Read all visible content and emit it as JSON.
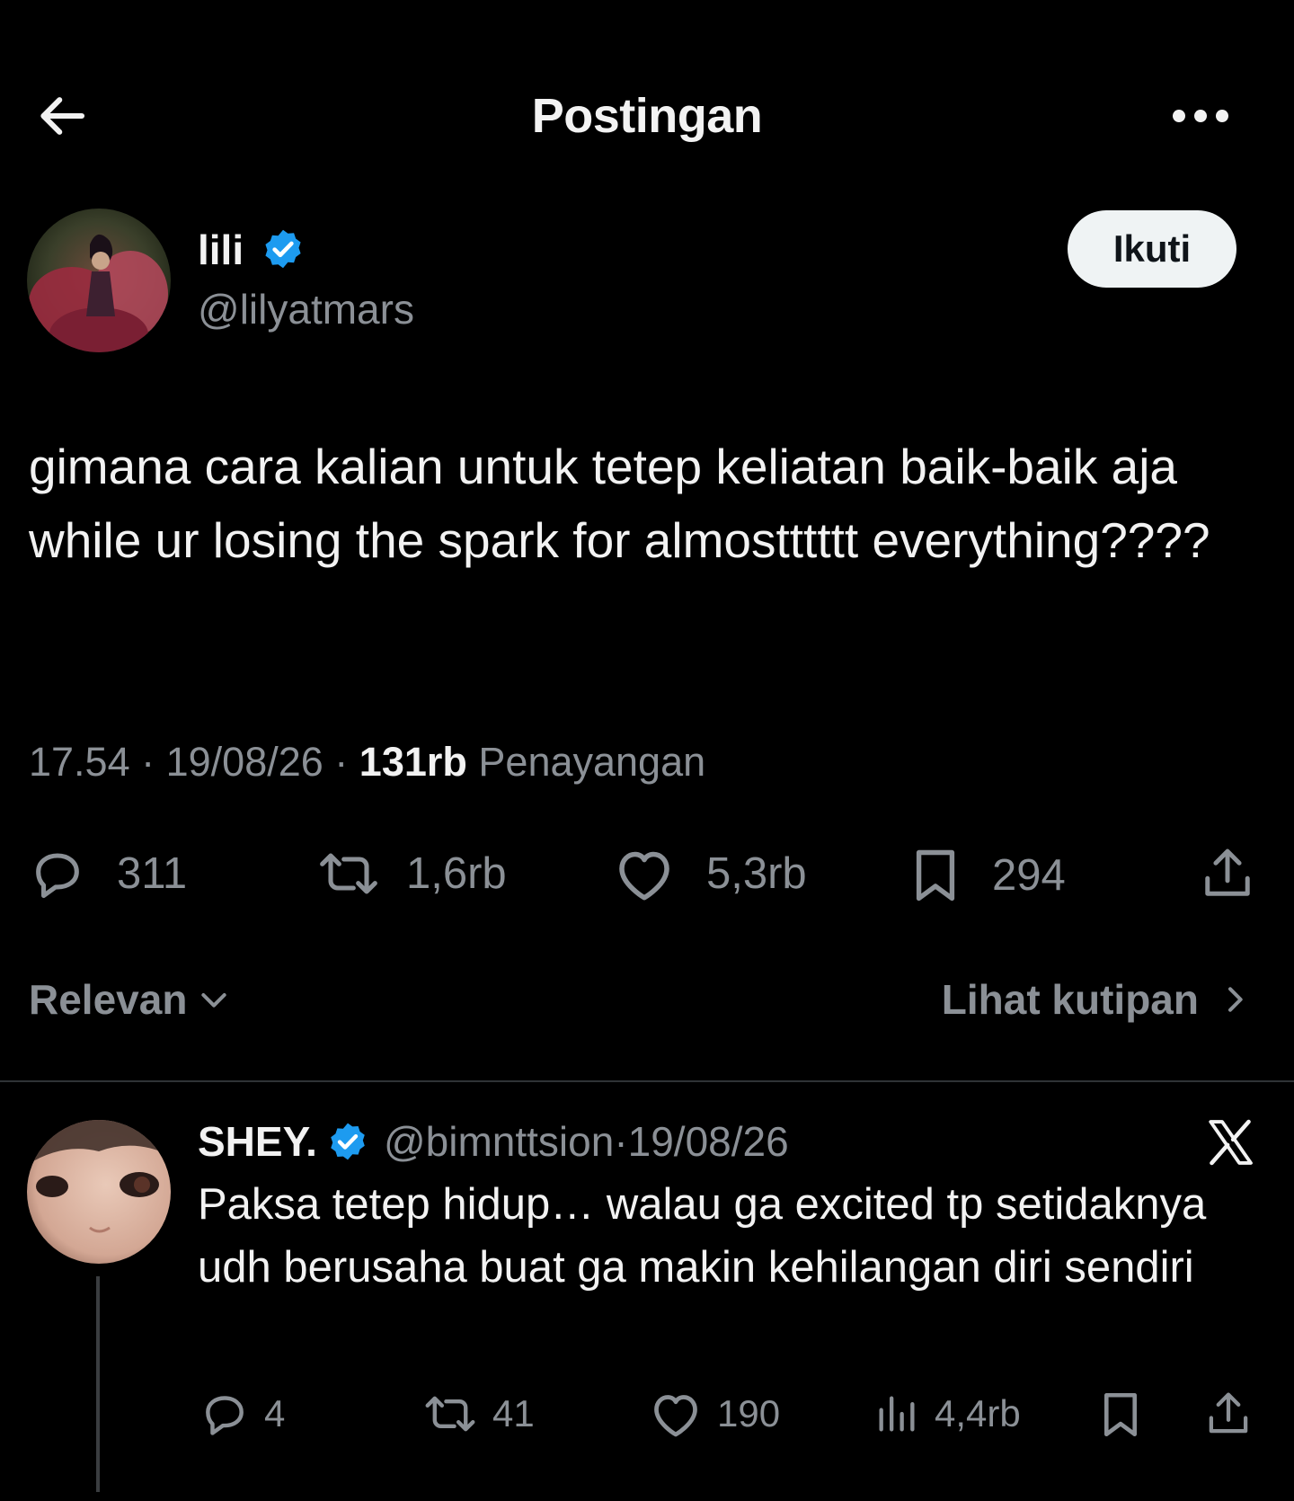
{
  "header": {
    "title": "Postingan"
  },
  "post": {
    "author_name": "lili",
    "author_handle": "@lilyatmars",
    "follow_label": "Ikuti",
    "text": "gimana cara kalian untuk tetep keliatan baik-baik aja while ur losing the spark for almostttttt everything????",
    "time": "17.54",
    "date": "19/08/26",
    "separator": " · ",
    "views_count": "131rb",
    "views_label": "Penayangan",
    "stats": {
      "replies": "311",
      "reposts": "1,6rb",
      "likes": "5,3rb",
      "bookmarks": "294"
    }
  },
  "sort": {
    "label": "Relevan",
    "quotes_link": "Lihat kutipan"
  },
  "reply": {
    "name": "SHEY.",
    "handle": "@bimnttsion",
    "separator": " · ",
    "date": "19/08/26",
    "text": "Paksa tetep hidup… walau ga excited tp setidaknya udh berusaha buat ga makin kehilangan diri sendiri",
    "stats": {
      "replies": "4",
      "reposts": "41",
      "likes": "190",
      "views": "4,4rb"
    }
  },
  "icons": {
    "back": "arrow-left-icon",
    "more": "more-horizontal-icon",
    "verified": "verified-badge-icon",
    "reply": "reply-bubble-icon",
    "repost": "repost-icon",
    "like": "heart-icon",
    "bookmark": "bookmark-icon",
    "share": "share-icon",
    "views": "views-bar-icon",
    "chevron_down": "chevron-down-icon",
    "chevron_right": "chevron-right-icon",
    "x_logo": "x-logo-icon"
  },
  "colors": {
    "background": "#000000",
    "text": "#e7e9ea",
    "muted": "#8b9096",
    "verified": "#1d9bf0",
    "button_bg": "#eff3f4"
  }
}
